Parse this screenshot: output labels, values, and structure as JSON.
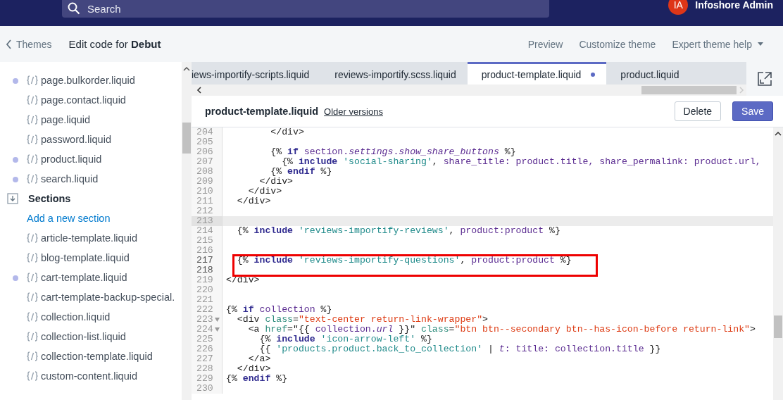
{
  "topbar": {
    "search": {
      "placeholder": "Search"
    },
    "account": {
      "initials": "IA",
      "name": "Infoshore Admin"
    }
  },
  "header": {
    "back": "Themes",
    "title": "Edit code for **Debut**",
    "links": [
      {
        "label": "Preview",
        "dropdown": false
      },
      {
        "label": "Customize theme",
        "dropdown": false
      },
      {
        "label": "Expert theme help",
        "dropdown": true
      }
    ]
  },
  "sidebar": {
    "items": [
      {
        "kind": "file",
        "label": "page.bulkorder.liquid",
        "modified": true
      },
      {
        "kind": "file",
        "label": "page.contact.liquid",
        "modified": false
      },
      {
        "kind": "file",
        "label": "page.liquid",
        "modified": false
      },
      {
        "kind": "file",
        "label": "password.liquid",
        "modified": false
      },
      {
        "kind": "file",
        "label": "product.liquid",
        "modified": true
      },
      {
        "kind": "file",
        "label": "search.liquid",
        "modified": true
      },
      {
        "kind": "heading",
        "label": "Sections"
      },
      {
        "kind": "link",
        "label": "Add a new section"
      },
      {
        "kind": "file",
        "label": "article-template.liquid",
        "modified": false
      },
      {
        "kind": "file",
        "label": "blog-template.liquid",
        "modified": false
      },
      {
        "kind": "file",
        "label": "cart-template.liquid",
        "modified": true
      },
      {
        "kind": "file",
        "label": "cart-template-backup-special.",
        "modified": false
      },
      {
        "kind": "file",
        "label": "collection.liquid",
        "modified": false
      },
      {
        "kind": "file",
        "label": "collection-list.liquid",
        "modified": false
      },
      {
        "kind": "file",
        "label": "collection-template.liquid",
        "modified": false
      },
      {
        "kind": "file",
        "label": "custom-content.liquid",
        "modified": false
      }
    ]
  },
  "tabs": [
    {
      "label": "iews-importify-scripts.liquid",
      "selected": false,
      "unsaved": false
    },
    {
      "label": "reviews-importify.scss.liquid",
      "selected": false,
      "unsaved": false
    },
    {
      "label": "product-template.liquid",
      "selected": true,
      "unsaved": true
    },
    {
      "label": "product.liquid",
      "selected": false,
      "unsaved": false
    }
  ],
  "file_header": {
    "filename": "product-template.liquid",
    "versions_link": "Older versions",
    "buttons": [
      {
        "label": "Delete",
        "kind": "secondary"
      },
      {
        "label": "Save",
        "kind": "primary"
      }
    ]
  },
  "code": {
    "lines": [
      {
        "number": "204",
        "active": false,
        "boxed": false,
        "foldable": false,
        "tokens": [
          {
            "kind": "tag",
            "text": "        </div>"
          }
        ]
      },
      {
        "number": "205",
        "active": false,
        "boxed": false,
        "foldable": false
      },
      {
        "number": "206",
        "active": false,
        "boxed": false,
        "foldable": false,
        "tokens": [
          {
            "kind": "punct",
            "text": "        {% "
          },
          {
            "kind": "keyword",
            "text": "if"
          },
          {
            "kind": "variable",
            "text": " section."
          },
          {
            "kind": "italic",
            "text": "settings"
          },
          {
            "kind": "variable",
            "text": "."
          },
          {
            "kind": "italic",
            "text": "show_share_buttons"
          },
          {
            "kind": "punct",
            "text": " %}"
          }
        ]
      },
      {
        "number": "207",
        "active": false,
        "boxed": false,
        "foldable": false,
        "tokens": [
          {
            "kind": "punct",
            "text": "          {% "
          },
          {
            "kind": "keyword",
            "text": "include"
          },
          {
            "kind": "string",
            "text": " 'social-sharing'"
          },
          {
            "kind": "punct",
            "text": ", "
          },
          {
            "kind": "variable",
            "text": "share_title: product.title, share_permalink: product.url,"
          }
        ]
      },
      {
        "number": "208",
        "active": false,
        "boxed": false,
        "foldable": false,
        "tokens": [
          {
            "kind": "punct",
            "text": "        {% "
          },
          {
            "kind": "keyword",
            "text": "endif"
          },
          {
            "kind": "punct",
            "text": " %}"
          }
        ]
      },
      {
        "number": "209",
        "active": false,
        "boxed": false,
        "foldable": false,
        "tokens": [
          {
            "kind": "tag",
            "text": "      </div>"
          }
        ]
      },
      {
        "number": "210",
        "active": false,
        "boxed": false,
        "foldable": false,
        "tokens": [
          {
            "kind": "tag",
            "text": "    </div>"
          }
        ]
      },
      {
        "number": "211",
        "active": false,
        "boxed": false,
        "foldable": false,
        "tokens": [
          {
            "kind": "tag",
            "text": "  </div>"
          }
        ]
      },
      {
        "number": "212",
        "active": false,
        "boxed": false,
        "foldable": false
      },
      {
        "number": "213",
        "active": true,
        "boxed": false,
        "foldable": false
      },
      {
        "number": "214",
        "active": false,
        "boxed": false,
        "foldable": false,
        "tokens": [
          {
            "kind": "punct",
            "text": "  {% "
          },
          {
            "kind": "keyword",
            "text": "include"
          },
          {
            "kind": "string",
            "text": " 'reviews-importify-reviews'"
          },
          {
            "kind": "punct",
            "text": ", "
          },
          {
            "kind": "variable",
            "text": "product:product"
          },
          {
            "kind": "punct",
            "text": " %}"
          }
        ]
      },
      {
        "number": "215",
        "active": false,
        "boxed": false,
        "foldable": false
      },
      {
        "number": "216",
        "active": false,
        "boxed": false,
        "foldable": false
      },
      {
        "number": "217",
        "active": false,
        "boxed": true,
        "foldable": false,
        "tokens": [
          {
            "kind": "punct",
            "text": "  {% "
          },
          {
            "kind": "keyword",
            "text": "include"
          },
          {
            "kind": "string",
            "text": " 'reviews-importify-questions'"
          },
          {
            "kind": "punct",
            "text": ", "
          },
          {
            "kind": "variable",
            "text": "product:product"
          },
          {
            "kind": "punct",
            "text": " %}"
          }
        ]
      },
      {
        "number": "218",
        "active": false,
        "boxed": true,
        "foldable": false
      },
      {
        "number": "219",
        "active": false,
        "boxed": false,
        "foldable": false,
        "tokens": [
          {
            "kind": "tag",
            "text": "</div>"
          }
        ]
      },
      {
        "number": "220",
        "active": false,
        "boxed": false,
        "foldable": false
      },
      {
        "number": "221",
        "active": false,
        "boxed": false,
        "foldable": false
      },
      {
        "number": "222",
        "active": false,
        "boxed": false,
        "foldable": false,
        "tokens": [
          {
            "kind": "punct",
            "text": "{% "
          },
          {
            "kind": "keyword",
            "text": "if"
          },
          {
            "kind": "variable",
            "text": " collection"
          },
          {
            "kind": "punct",
            "text": " %}"
          }
        ]
      },
      {
        "number": "223",
        "active": false,
        "boxed": false,
        "foldable": true,
        "tokens": [
          {
            "kind": "tag",
            "text": "  <div "
          },
          {
            "kind": "attr",
            "text": "class"
          },
          {
            "kind": "tag",
            "text": "="
          },
          {
            "kind": "value",
            "text": "\"text-center return-link-wrapper\""
          },
          {
            "kind": "tag",
            "text": ">"
          }
        ]
      },
      {
        "number": "224",
        "active": false,
        "boxed": false,
        "foldable": true,
        "tokens": [
          {
            "kind": "tag",
            "text": "    <a "
          },
          {
            "kind": "attr",
            "text": "href"
          },
          {
            "kind": "tag",
            "text": "="
          },
          {
            "kind": "punct",
            "text": "\"{{ "
          },
          {
            "kind": "variable",
            "text": "collection."
          },
          {
            "kind": "italic",
            "text": "url"
          },
          {
            "kind": "punct",
            "text": " }}\" "
          },
          {
            "kind": "attr",
            "text": "class"
          },
          {
            "kind": "tag",
            "text": "="
          },
          {
            "kind": "value",
            "text": "\"btn btn--secondary btn--has-icon-before return-link\""
          },
          {
            "kind": "tag",
            "text": ">"
          }
        ]
      },
      {
        "number": "225",
        "active": false,
        "boxed": false,
        "foldable": false,
        "tokens": [
          {
            "kind": "punct",
            "text": "      {% "
          },
          {
            "kind": "keyword",
            "text": "include"
          },
          {
            "kind": "string",
            "text": " 'icon-arrow-left'"
          },
          {
            "kind": "punct",
            "text": " %}"
          }
        ]
      },
      {
        "number": "226",
        "active": false,
        "boxed": false,
        "foldable": false,
        "tokens": [
          {
            "kind": "punct",
            "text": "      {{ "
          },
          {
            "kind": "string",
            "text": "'products.product.back_to_collection'"
          },
          {
            "kind": "punct",
            "text": " | "
          },
          {
            "kind": "italic",
            "text": "t"
          },
          {
            "kind": "variable",
            "text": ": title: collection.title"
          },
          {
            "kind": "punct",
            "text": " }}"
          }
        ]
      },
      {
        "number": "227",
        "active": false,
        "boxed": false,
        "foldable": false,
        "tokens": [
          {
            "kind": "tag",
            "text": "    </a>"
          }
        ]
      },
      {
        "number": "228",
        "active": false,
        "boxed": false,
        "foldable": false,
        "tokens": [
          {
            "kind": "tag",
            "text": "  </div>"
          }
        ]
      },
      {
        "number": "229",
        "active": false,
        "boxed": false,
        "foldable": false,
        "tokens": [
          {
            "kind": "punct",
            "text": "{% "
          },
          {
            "kind": "keyword",
            "text": "endif"
          },
          {
            "kind": "punct",
            "text": " %}"
          }
        ]
      },
      {
        "number": "230",
        "active": false,
        "boxed": false,
        "foldable": false
      }
    ]
  }
}
